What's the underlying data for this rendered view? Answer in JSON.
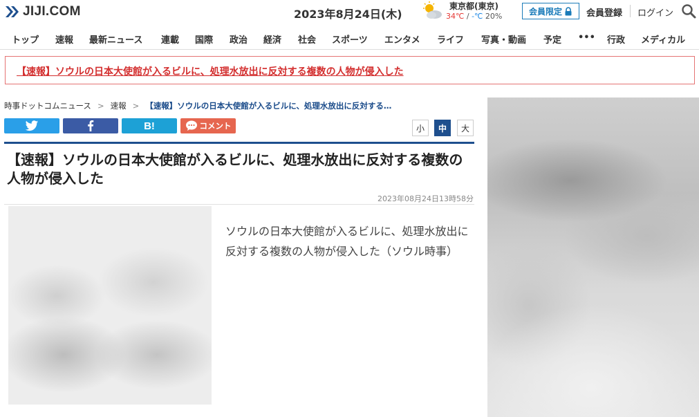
{
  "header": {
    "logo_text": "JIJI.COM",
    "date": "2023年8月24日(木)",
    "weather": {
      "city": "東京都(東京)",
      "temp_high": "34℃",
      "temp_sep": " / ",
      "temp_low": "-℃",
      "precip": " 20%"
    },
    "member_badge": "会員限定",
    "register": "会員登録",
    "login": "ログイン"
  },
  "nav": {
    "items": [
      "トップ",
      "速報",
      "最新ニュース",
      "連載",
      "国際",
      "政治",
      "経済",
      "社会",
      "スポーツ",
      "エンタメ",
      "ライフ",
      "写真・動画",
      "予定",
      "•••",
      "行政",
      "メディカル"
    ]
  },
  "breaking": {
    "text": "【速報】ソウルの日本大使館が入るビルに、処理水放出に反対する複数の人物が侵入した"
  },
  "breadcrumb": {
    "items": [
      "時事ドットコムニュース",
      "速報"
    ],
    "current": "【速報】ソウルの日本大使館が入るビルに、処理水放出に反対する…",
    "separator": ">"
  },
  "share": {
    "hatena_label": "B!",
    "comment_label": "コメント"
  },
  "font_size": {
    "small": "小",
    "medium": "中",
    "large": "大",
    "selected": "中"
  },
  "article": {
    "headline": "【速報】ソウルの日本大使館が入るビルに、処理水放出に反対する複数の人物が侵入した",
    "published": "2023年08月24日13時58分",
    "body": "ソウルの日本大使館が入るビルに、処理水放出に反対する複数の人物が侵入した（ソウル時事）"
  },
  "colors": {
    "brand_navy": "#1e4f8e",
    "breaking_red": "#d32f2f",
    "twitter": "#2a9fe8",
    "facebook": "#3b5ba5",
    "hatena": "#1da1d6",
    "comment": "#e6664f"
  },
  "icons": [
    "jiji-logo-icon",
    "partly-cloudy-icon",
    "lock-icon",
    "search-icon",
    "twitter-bird-icon",
    "facebook-f-icon",
    "speech-bubble-icon"
  ]
}
